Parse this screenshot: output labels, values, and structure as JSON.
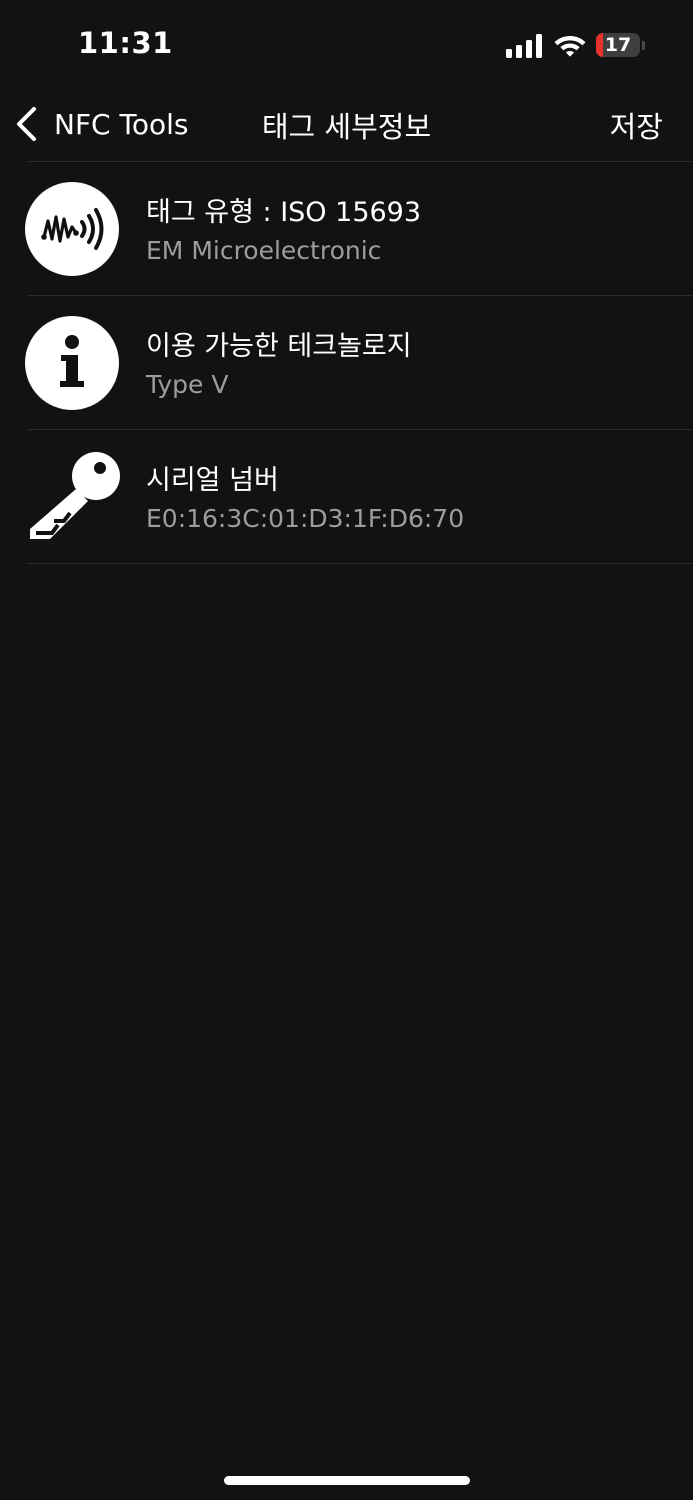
{
  "status_bar": {
    "time": "11:31",
    "battery_level": "17",
    "battery_color": "#e5322b",
    "signal_icon": "cellular-signal-icon",
    "wifi_icon": "wifi-icon"
  },
  "nav": {
    "back_label": "NFC Tools",
    "title": "태그 세부정보",
    "save_label": "저장"
  },
  "rows": [
    {
      "icon": "nfc-wave-icon",
      "title": "태그 유형 : ISO 15693",
      "subtitle": "EM Microelectronic"
    },
    {
      "icon": "info-icon",
      "title": "이용 가능한 테크놀로지",
      "subtitle": "Type V"
    },
    {
      "icon": "key-icon",
      "title": "시리얼 넘버",
      "subtitle": "E0:16:3C:01:D3:1F:D6:70"
    }
  ],
  "colors": {
    "background": "#121212",
    "text_primary": "#ffffff",
    "text_secondary": "#9d9d9d",
    "divider": "#2c2c2c"
  }
}
